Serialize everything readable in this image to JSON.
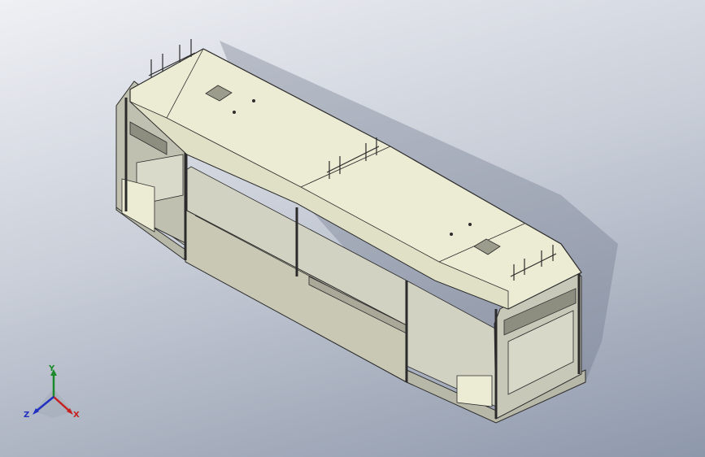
{
  "viewport": {
    "background_top": "#eef0f4",
    "background_bottom": "#8e98ab",
    "model_name": ""
  },
  "model": {
    "panel_color": "#ececd4",
    "frame_color": "#b8b8a8",
    "side_panel_color": "#c8c8b4",
    "edge_color": "#2b2b2b"
  },
  "triad": {
    "x_label": "X",
    "y_label": "Y",
    "z_label": "Z",
    "x_color": "#c62020",
    "y_color": "#1a8a2a",
    "z_color": "#2030c0"
  }
}
